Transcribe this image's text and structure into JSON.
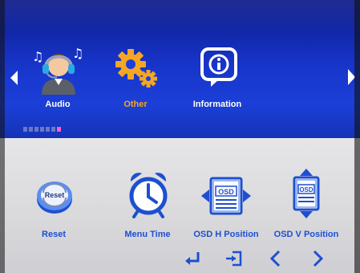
{
  "top_menu": {
    "items": [
      {
        "label": "Audio",
        "icon": "headset-person-icon",
        "selected": false
      },
      {
        "label": "Other",
        "icon": "gears-icon",
        "selected": true
      },
      {
        "label": "Information",
        "icon": "info-icon",
        "selected": false
      }
    ],
    "page_indicator": {
      "count": 7,
      "active_index": 6
    }
  },
  "sub_menu": {
    "items": [
      {
        "label": "Reset",
        "icon": "reset-icon"
      },
      {
        "label": "Menu Time",
        "icon": "alarm-clock-icon"
      },
      {
        "label": "OSD H Position",
        "icon": "osd-h-position-icon"
      },
      {
        "label": "OSD V Position",
        "icon": "osd-v-position-icon"
      }
    ]
  },
  "icon_text": {
    "reset": "Reset",
    "osd_h": "OSD",
    "osd_v": "OSD"
  },
  "navigation": {
    "buttons": [
      "enter-icon",
      "exit-icon",
      "previous-icon",
      "next-icon"
    ]
  },
  "colors": {
    "header_blue": "#1b3fd8",
    "selected_orange": "#f5a623",
    "sub_label_blue": "#1d4fd0",
    "page_dot_active": "#ff5ec8",
    "body_gray": "#dcdcdf"
  }
}
